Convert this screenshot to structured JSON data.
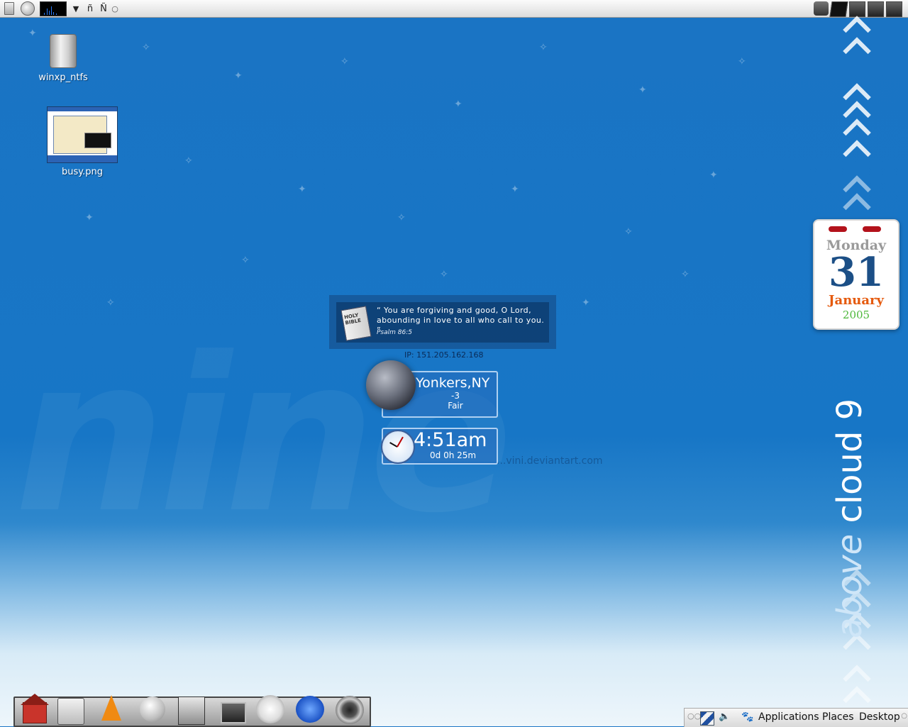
{
  "top_panel": {
    "char_1": "ñ",
    "char_2": "Ñ",
    "char_3": "○",
    "arrow": "▼",
    "left_icons": [
      "trash-icon",
      "browser-icon",
      "system-monitor-applet",
      "menu-arrow-icon"
    ],
    "right_icons": [
      "camera-icon",
      "screen-icon",
      "disk-icon",
      "disk-icon",
      "disk-icon"
    ]
  },
  "desktop_icons": [
    {
      "label": "winxp_ntfs",
      "icon": "hard-drive-icon"
    },
    {
      "label": "busy.png",
      "icon": "image-thumbnail-icon"
    }
  ],
  "calendar": {
    "weekday": "Monday",
    "day": "31",
    "month": "January",
    "year": "2005"
  },
  "quote": {
    "text": "“ You are forgiving and good, O Lord, abounding in love to all who call to you. ”",
    "reference": "Psalm 86:5",
    "icon_text": "HOLY BIBLE"
  },
  "network": {
    "ip": "IP: 151.205.162.168"
  },
  "weather": {
    "city": "Yonkers,NY",
    "temperature": "-3",
    "condition": "Fair"
  },
  "clock": {
    "time": "4:51am",
    "uptime": "0d 0h 25m"
  },
  "watermark": {
    "text": "nine",
    "url": "...vini.deviantart.com"
  },
  "wallpaper": {
    "tagline_main": "above",
    "tagline_rest": " cloud 9"
  },
  "dock": {
    "items": [
      "home-icon",
      "package-manager-icon",
      "vlc-icon",
      "moon-icon",
      "radio-icon",
      "tv-icon",
      "chat-icon",
      "realplayer-icon",
      "speaker-icon"
    ]
  },
  "bottom_panel": {
    "oo": "○○",
    "applications": "Applications",
    "places": "Places",
    "desktop": "Desktop",
    "end": "○",
    "volume": "🔈",
    "foot": "🐾"
  },
  "colors": {
    "desktop_blue": "#1a74c4",
    "calendar_date": "#1c4f86",
    "calendar_month": "#e55a0e",
    "calendar_year": "#4db83a"
  }
}
